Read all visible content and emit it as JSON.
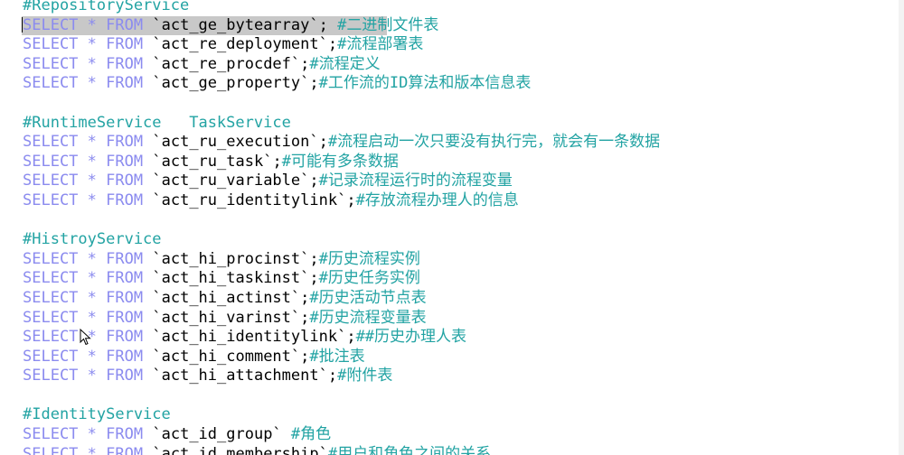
{
  "editor": {
    "caret_line": 1,
    "highlight_line": 1,
    "colors": {
      "keyword": "#8b8bef",
      "comment": "#22a3a3",
      "highlight": "#c8c8c8",
      "background": "#ffffff"
    },
    "lines": [
      {
        "kind": "header",
        "text": "#RepositoryService"
      },
      {
        "kind": "sql",
        "kw1": "SELECT",
        "star": "*",
        "kw2": "FROM",
        "table": "`act_ge_bytearray`",
        "sep": "; ",
        "comment": "#二进制文件表"
      },
      {
        "kind": "sql",
        "kw1": "SELECT",
        "star": "*",
        "kw2": "FROM",
        "table": "`act_re_deployment`",
        "sep": ";",
        "comment": "#流程部署表"
      },
      {
        "kind": "sql",
        "kw1": "SELECT",
        "star": "*",
        "kw2": "FROM",
        "table": "`act_re_procdef`",
        "sep": ";",
        "comment": "#流程定义"
      },
      {
        "kind": "sql",
        "kw1": "SELECT",
        "star": "*",
        "kw2": "FROM",
        "table": "`act_ge_property`",
        "sep": ";",
        "comment": "#工作流的ID算法和版本信息表"
      },
      {
        "kind": "blank",
        "text": ""
      },
      {
        "kind": "header",
        "text": "#RuntimeService   TaskService"
      },
      {
        "kind": "sql",
        "kw1": "SELECT",
        "star": "*",
        "kw2": "FROM",
        "table": "`act_ru_execution`",
        "sep": ";",
        "comment": "#流程启动一次只要没有执行完，就会有一条数据"
      },
      {
        "kind": "sql",
        "kw1": "SELECT",
        "star": "*",
        "kw2": "FROM",
        "table": "`act_ru_task`",
        "sep": ";",
        "comment": "#可能有多条数据"
      },
      {
        "kind": "sql",
        "kw1": "SELECT",
        "star": "*",
        "kw2": "FROM",
        "table": "`act_ru_variable`",
        "sep": ";",
        "comment": "#记录流程运行时的流程变量"
      },
      {
        "kind": "sql",
        "kw1": "SELECT",
        "star": "*",
        "kw2": "FROM",
        "table": "`act_ru_identitylink`",
        "sep": ";",
        "comment": "#存放流程办理人的信息"
      },
      {
        "kind": "blank",
        "text": ""
      },
      {
        "kind": "header",
        "text": "#HistroyService"
      },
      {
        "kind": "sql",
        "kw1": "SELECT",
        "star": "*",
        "kw2": "FROM",
        "table": "`act_hi_procinst`",
        "sep": ";",
        "comment": "#历史流程实例"
      },
      {
        "kind": "sql",
        "kw1": "SELECT",
        "star": "*",
        "kw2": "FROM",
        "table": "`act_hi_taskinst`",
        "sep": ";",
        "comment": "#历史任务实例"
      },
      {
        "kind": "sql",
        "kw1": "SELECT",
        "star": "*",
        "kw2": "FROM",
        "table": "`act_hi_actinst`",
        "sep": ";",
        "comment": "#历史活动节点表"
      },
      {
        "kind": "sql",
        "kw1": "SELECT",
        "star": "*",
        "kw2": "FROM",
        "table": "`act_hi_varinst`",
        "sep": ";",
        "comment": "#历史流程变量表"
      },
      {
        "kind": "sql",
        "kw1": "SELECT",
        "star": "*",
        "kw2": "FROM",
        "table": "`act_hi_identitylink`",
        "sep": ";",
        "comment": "##历史办理人表"
      },
      {
        "kind": "sql",
        "kw1": "SELECT",
        "star": "*",
        "kw2": "FROM",
        "table": "`act_hi_comment`",
        "sep": ";",
        "comment": "#批注表"
      },
      {
        "kind": "sql",
        "kw1": "SELECT",
        "star": "*",
        "kw2": "FROM",
        "table": "`act_hi_attachment`",
        "sep": ";",
        "comment": "#附件表"
      },
      {
        "kind": "blank",
        "text": ""
      },
      {
        "kind": "header",
        "text": "#IdentityService"
      },
      {
        "kind": "sql",
        "kw1": "SELECT",
        "star": "*",
        "kw2": "FROM",
        "table": "`act_id_group`",
        "sep": " ",
        "comment": "#角色"
      },
      {
        "kind": "sql",
        "kw1": "SELECT",
        "star": "*",
        "kw2": "FROM",
        "table": "`act_id_membership`",
        "sep": "",
        "comment": "#用户和角色之间的关系"
      }
    ]
  }
}
